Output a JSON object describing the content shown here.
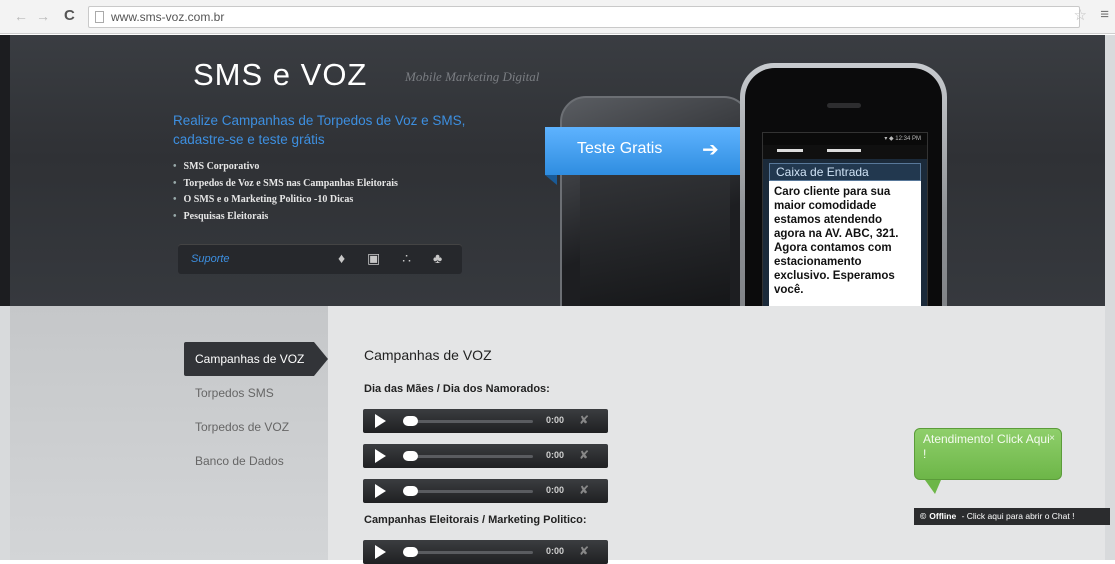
{
  "browser": {
    "back_icon": "back-arrow-icon",
    "forward_icon": "forward-arrow-icon",
    "reload_symbol": "C",
    "url": "www.sms-voz.com.br",
    "star_symbol": "☆",
    "menu_symbol": "≡"
  },
  "banner": {
    "logo": "SMS  e VOZ",
    "logo_sub": "Mobile Marketing Digital",
    "headline": "Realize Campanhas de Torpedos de Voz e SMS, cadastre-se e teste grátis",
    "bullets": [
      "SMS Corporativo",
      "Torpedos de Voz e SMS nas Campanhas Eleitorais",
      "O SMS e o Marketing Politico -10 Dicas",
      "Pesquisas Eleitorais"
    ],
    "support_label": "Suporte",
    "os_icons": "apple-icon windows-icon blackberry-icon android-icon",
    "os_glyphs": "♦ ▣ ∴ ♣",
    "cta": "Teste Gratis",
    "cta_arrow": "➔"
  },
  "phone": {
    "status": "▾ ◆ 12:34 PM",
    "inbox_title": "Caixa de Entrada",
    "message": "Caro cliente para sua maior comodidade estamos atendendo agora na AV. ABC, 321. Agora contamos com estacionamento exclusivo. Esperamos você."
  },
  "carousel": {
    "dots": "●●●○●●●●●"
  },
  "sidenav": {
    "items": [
      {
        "label": "Campanhas de VOZ",
        "active": true
      },
      {
        "label": "Torpedos SMS",
        "active": false
      },
      {
        "label": "Torpedos de VOZ",
        "active": false
      },
      {
        "label": "Banco de Dados",
        "active": false
      }
    ]
  },
  "content": {
    "title": "Campanhas de VOZ",
    "section1": "Dia das Mães / Dia dos Namorados:",
    "section2": "Campanhas Eleitorais / Marketing Politico:",
    "players": [
      {
        "time": "0:00"
      },
      {
        "time": "0:00"
      },
      {
        "time": "0:00"
      },
      {
        "time": "0:00"
      }
    ],
    "volume_icon": "speaker-muted-icon",
    "volume_glyph": "✘"
  },
  "chat": {
    "bubble_text": "Atendimento! Click Aqui !",
    "close_symbol": "×",
    "status": "Offline",
    "bar_text": "- Click aqui para abrir o Chat !",
    "icon_glyph": "©"
  },
  "colors": {
    "accent_blue": "#3d8fe0",
    "ribbon_blue": "#2f8de0",
    "chat_green": "#6db648",
    "banner_dark": "#2f3135"
  }
}
